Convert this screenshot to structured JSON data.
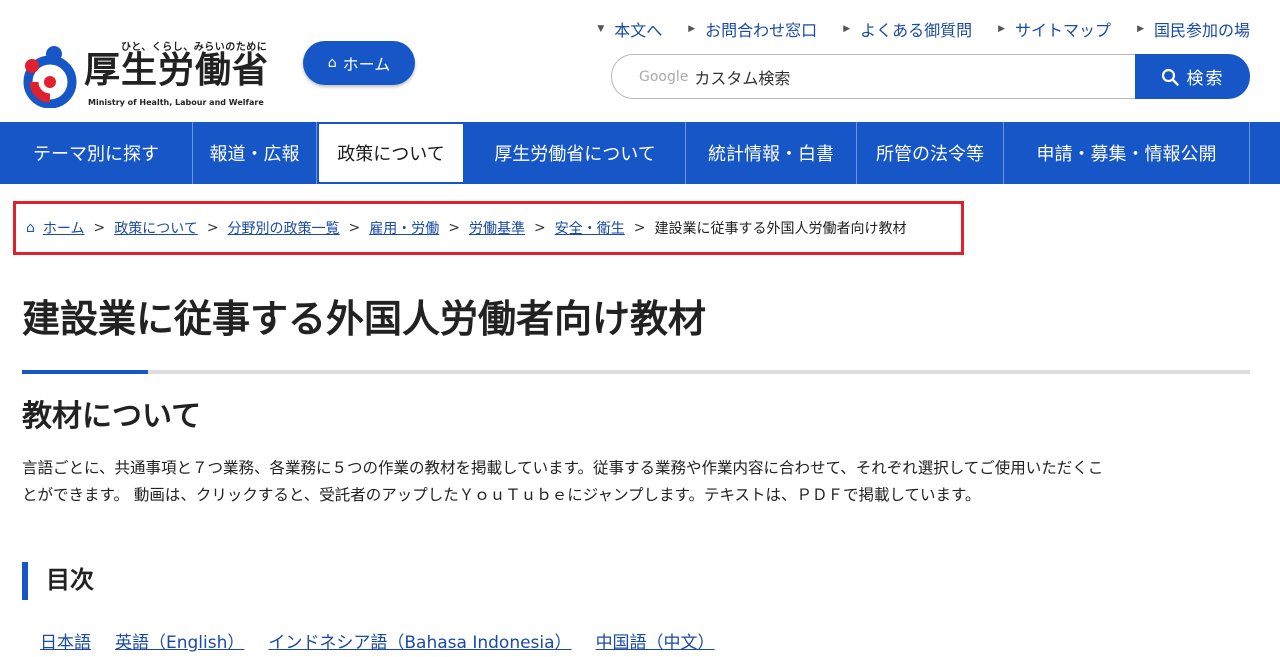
{
  "header": {
    "logo_tagline": "ひと、くらし、みらいのために",
    "logo_name": "厚生労働省",
    "logo_en": "Ministry of Health, Labour and Welfare",
    "home_button": "ホーム",
    "util_links": [
      {
        "label": "本文へ",
        "icon": "triangle-down"
      },
      {
        "label": "お問合わせ窓口",
        "icon": "triangle-right"
      },
      {
        "label": "よくある御質問",
        "icon": "triangle-right"
      },
      {
        "label": "サイトマップ",
        "icon": "triangle-right"
      },
      {
        "label": "国民参加の場",
        "icon": "triangle-right"
      }
    ],
    "search": {
      "google_label": "Google",
      "placeholder": "カスタム検索",
      "button": "検索"
    }
  },
  "nav": [
    {
      "label": "テーマ別に探す"
    },
    {
      "label": "報道・広報"
    },
    {
      "label": "政策について"
    },
    {
      "label": "厚生労働省について"
    },
    {
      "label": "統計情報・白書"
    },
    {
      "label": "所管の法令等"
    },
    {
      "label": "申請・募集・情報公開"
    }
  ],
  "breadcrumb": [
    {
      "label": "ホーム"
    },
    {
      "label": "政策について"
    },
    {
      "label": "分野別の政策一覧"
    },
    {
      "label": "雇用・労働"
    },
    {
      "label": "労働基準"
    },
    {
      "label": "安全・衛生"
    }
  ],
  "breadcrumb_current": "建設業に従事する外国人労働者向け教材",
  "breadcrumb_sep": ">",
  "page_title": "建設業に従事する外国人労働者向け教材",
  "section_title": "教材について",
  "paragraph_line1": "言語ごとに、共通事項と７つ業務、各業務に５つの作業の教材を掲載しています。従事する業務や作業内容に合わせて、それぞれ選択してご使用いただくこ",
  "paragraph_line2": "とができます。 動画は、クリックすると、受託者のアップしたＹｏｕＴｕｂｅにジャンプします。テキストは、ＰＤＦで掲載しています。",
  "toc_title": "目次",
  "toc_links": [
    {
      "label": "日本語"
    },
    {
      "label": "英語（English）"
    },
    {
      "label": "インドネシア語（Bahasa Indonesia）"
    },
    {
      "label": "中国語（中文）"
    }
  ],
  "colors": {
    "brand_blue": "#1656c6",
    "highlight_red": "#e0202b"
  }
}
